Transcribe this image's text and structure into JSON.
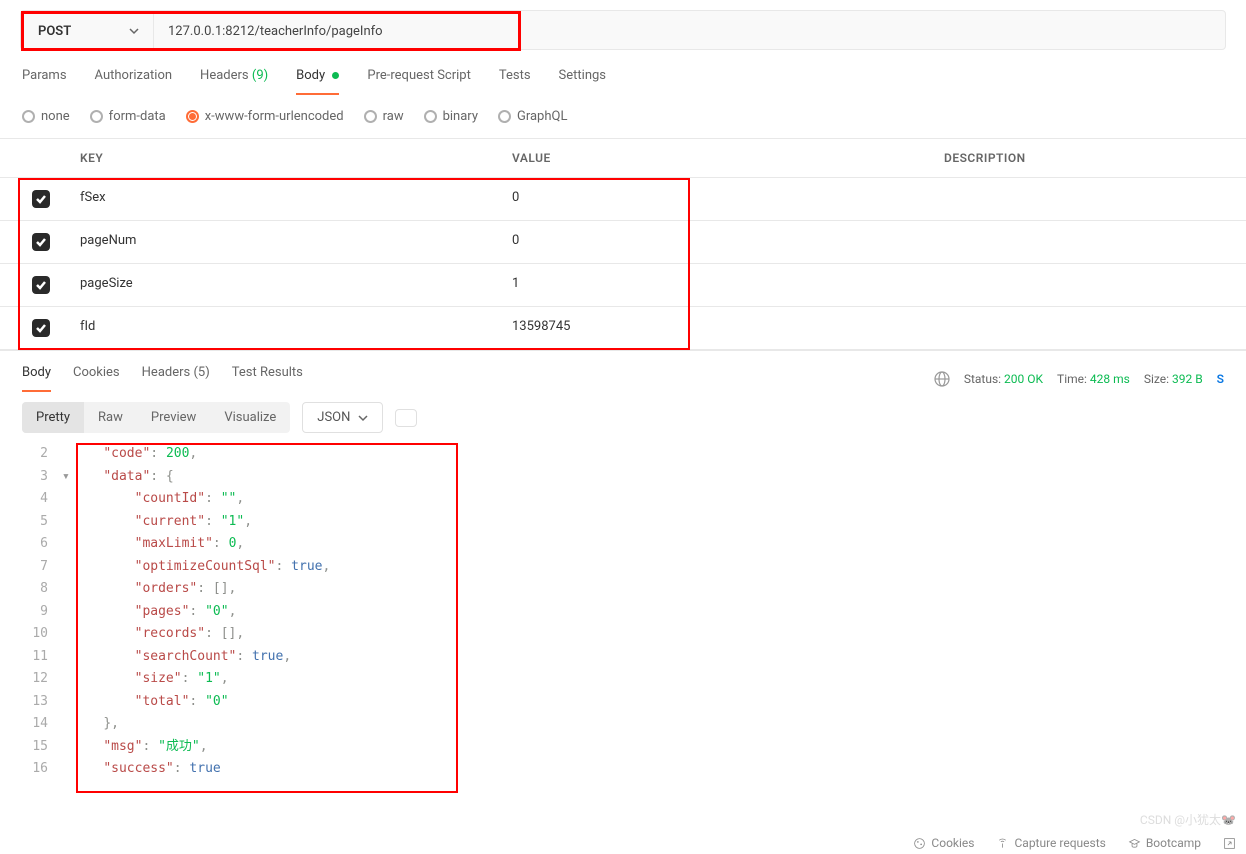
{
  "request": {
    "method": "POST",
    "url": "127.0.0.1:8212/teacherInfo/pageInfo"
  },
  "tabs": {
    "params": "Params",
    "authorization": "Authorization",
    "headers": "Headers",
    "headers_count": "(9)",
    "body": "Body",
    "prerequest": "Pre-request Script",
    "tests": "Tests",
    "settings": "Settings"
  },
  "body_types": {
    "none": "none",
    "formdata": "form-data",
    "urlencoded": "x-www-form-urlencoded",
    "raw": "raw",
    "binary": "binary",
    "graphql": "GraphQL"
  },
  "kv": {
    "header_key": "KEY",
    "header_value": "VALUE",
    "header_desc": "DESCRIPTION",
    "rows": [
      {
        "key": "fSex",
        "value": "0"
      },
      {
        "key": "pageNum",
        "value": "0"
      },
      {
        "key": "pageSize",
        "value": "1"
      },
      {
        "key": "fId",
        "value": "13598745"
      }
    ]
  },
  "response_tabs": {
    "body": "Body",
    "cookies": "Cookies",
    "headers": "Headers",
    "headers_count": "(5)",
    "testresults": "Test Results"
  },
  "response_meta": {
    "status_label": "Status:",
    "status_value": "200 OK",
    "time_label": "Time:",
    "time_value": "428 ms",
    "size_label": "Size:",
    "size_value": "392 B",
    "save_initial": "S"
  },
  "view_modes": {
    "pretty": "Pretty",
    "raw": "Raw",
    "preview": "Preview",
    "visualize": "Visualize",
    "format": "JSON"
  },
  "response_body": {
    "l2": "\"code\"",
    "l2v": "200",
    "l3": "\"data\"",
    "l4": "\"countId\"",
    "l4v": "\"\"",
    "l5": "\"current\"",
    "l5v": "\"1\"",
    "l6": "\"maxLimit\"",
    "l6v": "0",
    "l7": "\"optimizeCountSql\"",
    "l7v": "true",
    "l8": "\"orders\"",
    "l9": "\"pages\"",
    "l9v": "\"0\"",
    "l10": "\"records\"",
    "l11": "\"searchCount\"",
    "l11v": "true",
    "l12": "\"size\"",
    "l12v": "\"1\"",
    "l13": "\"total\"",
    "l13v": "\"0\"",
    "l15": "\"msg\"",
    "l15v": "\"成功\"",
    "l16": "\"success\"",
    "l16v": "true"
  },
  "watermark": "CSDN @小犹太🐭",
  "footer": {
    "cookies": "Cookies",
    "capture": "Capture requests",
    "bootcamp": "Bootcamp"
  }
}
